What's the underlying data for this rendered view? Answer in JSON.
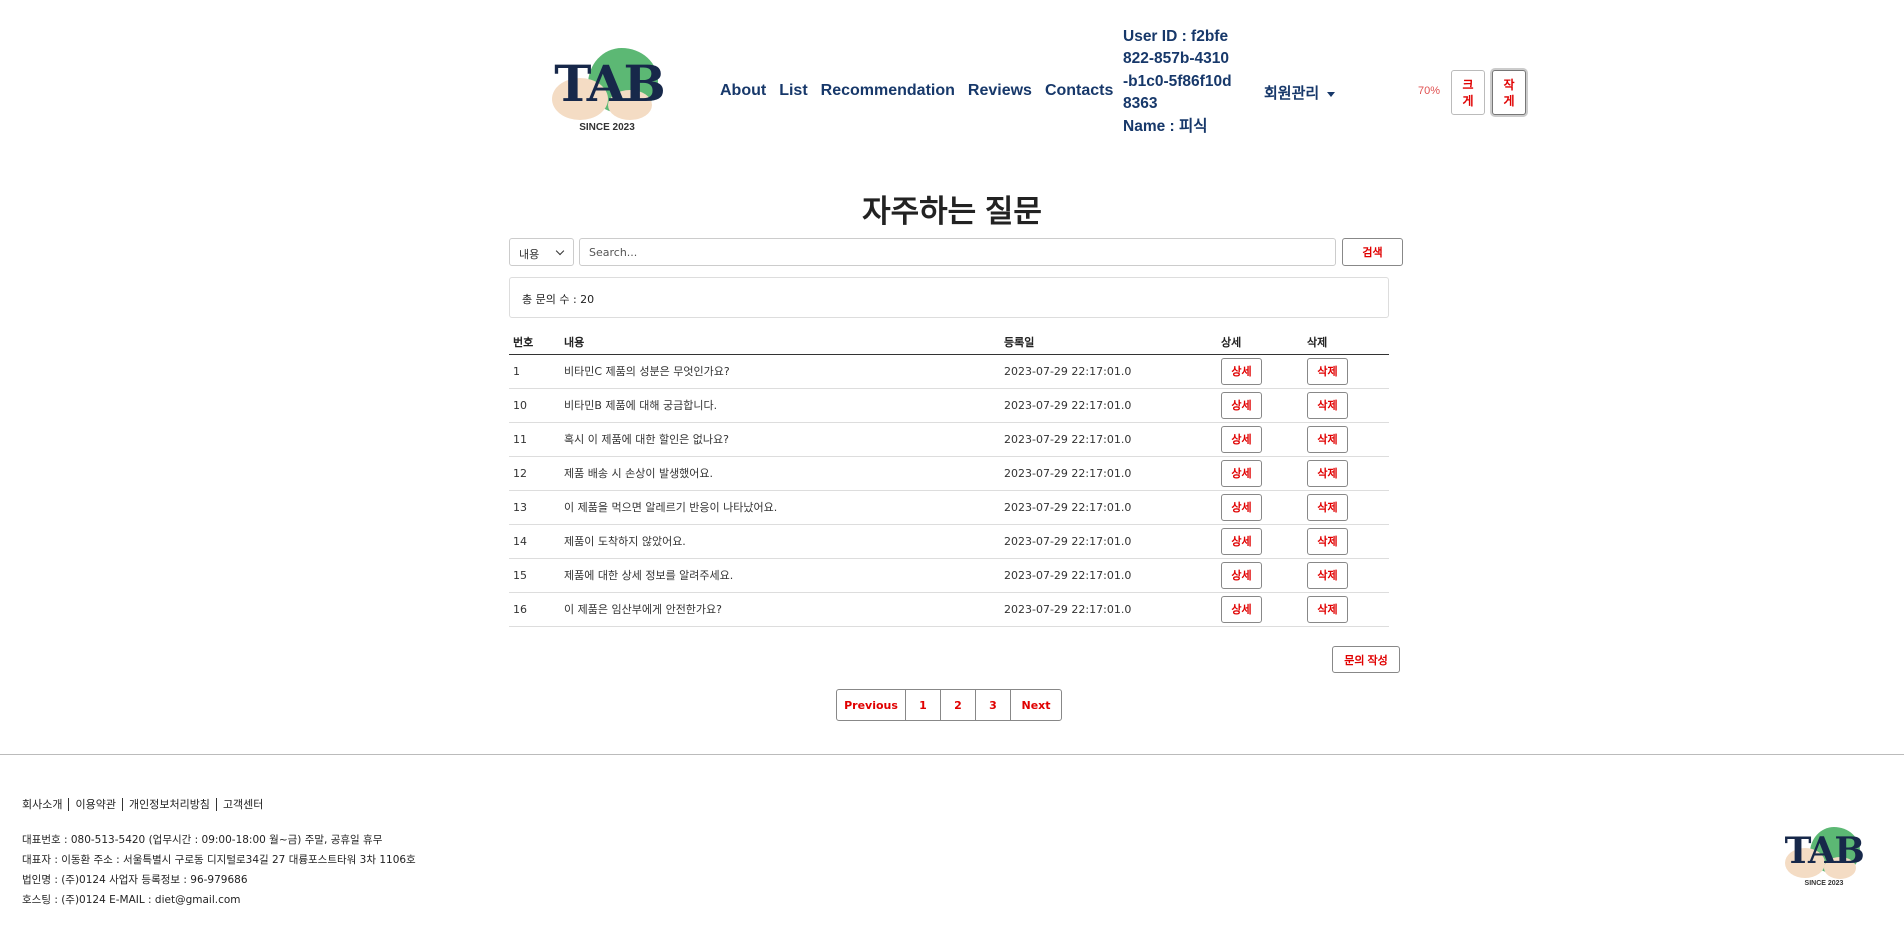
{
  "header": {
    "logo_text": "TAB",
    "logo_since": "SINCE 2023",
    "nav": [
      "About",
      "List",
      "Recommendation",
      "Reviews",
      "Contacts"
    ],
    "user_id_label": "User ID : f2bfe822-857b-4310-b1c0-5f86f10d8363",
    "user_name_label": "Name : 피식",
    "member_menu": "회원관리",
    "zoom_level": "70%",
    "zoom_in": "크게",
    "zoom_out": "작게"
  },
  "main": {
    "title": "자주하는 질문",
    "search": {
      "select_value": "내용",
      "placeholder": "Search...",
      "button": "검색"
    },
    "total_count": "총 문의 수 : 20",
    "table": {
      "headers": [
        "번호",
        "내용",
        "등록일",
        "상세",
        "삭제"
      ],
      "rows": [
        {
          "no": "1",
          "content": "비타민C 제품의 성분은 무엇인가요?",
          "date": "2023-07-29 22:17:01.0",
          "detail": "상세",
          "delete": "삭제"
        },
        {
          "no": "10",
          "content": "비타민B 제품에 대해 궁금합니다.",
          "date": "2023-07-29 22:17:01.0",
          "detail": "상세",
          "delete": "삭제"
        },
        {
          "no": "11",
          "content": "혹시 이 제품에 대한 할인은 없나요?",
          "date": "2023-07-29 22:17:01.0",
          "detail": "상세",
          "delete": "삭제"
        },
        {
          "no": "12",
          "content": "제품 배송 시 손상이 발생했어요.",
          "date": "2023-07-29 22:17:01.0",
          "detail": "상세",
          "delete": "삭제"
        },
        {
          "no": "13",
          "content": "이 제품을 먹으면 알레르기 반응이 나타났어요.",
          "date": "2023-07-29 22:17:01.0",
          "detail": "상세",
          "delete": "삭제"
        },
        {
          "no": "14",
          "content": "제품이 도착하지 않았어요.",
          "date": "2023-07-29 22:17:01.0",
          "detail": "상세",
          "delete": "삭제"
        },
        {
          "no": "15",
          "content": "제품에 대한 상세 정보를 알려주세요.",
          "date": "2023-07-29 22:17:01.0",
          "detail": "상세",
          "delete": "삭제"
        },
        {
          "no": "16",
          "content": "이 제품은 임산부에게 안전한가요?",
          "date": "2023-07-29 22:17:01.0",
          "detail": "상세",
          "delete": "삭제"
        }
      ]
    },
    "write_button": "문의 작성",
    "pagination": {
      "prev": "Previous",
      "pages": [
        "1",
        "2",
        "3"
      ],
      "next": "Next"
    }
  },
  "footer": {
    "links": [
      "회사소개",
      "이용약관",
      "개인정보처리방침",
      "고객센터"
    ],
    "info": [
      "대표번호 : 080-513-5420 (업무시간 : 09:00-18:00 월~금) 주말, 공휴일 휴무",
      "대표자 : 이동환     주소 : 서울특별시 구로동 디지털로34길 27 대륭포스트타워 3차 1106호",
      "법인명 : (주)0124 사업자 등록정보 : 96-979686",
      "호스팅 : (주)0124 E-MAIL : diet@gmail.com"
    ]
  },
  "colors": {
    "brand_navy": "#17386a",
    "logo_green": "#5cb874",
    "logo_peach": "#f4dcc4",
    "action_red": "#e00000"
  }
}
